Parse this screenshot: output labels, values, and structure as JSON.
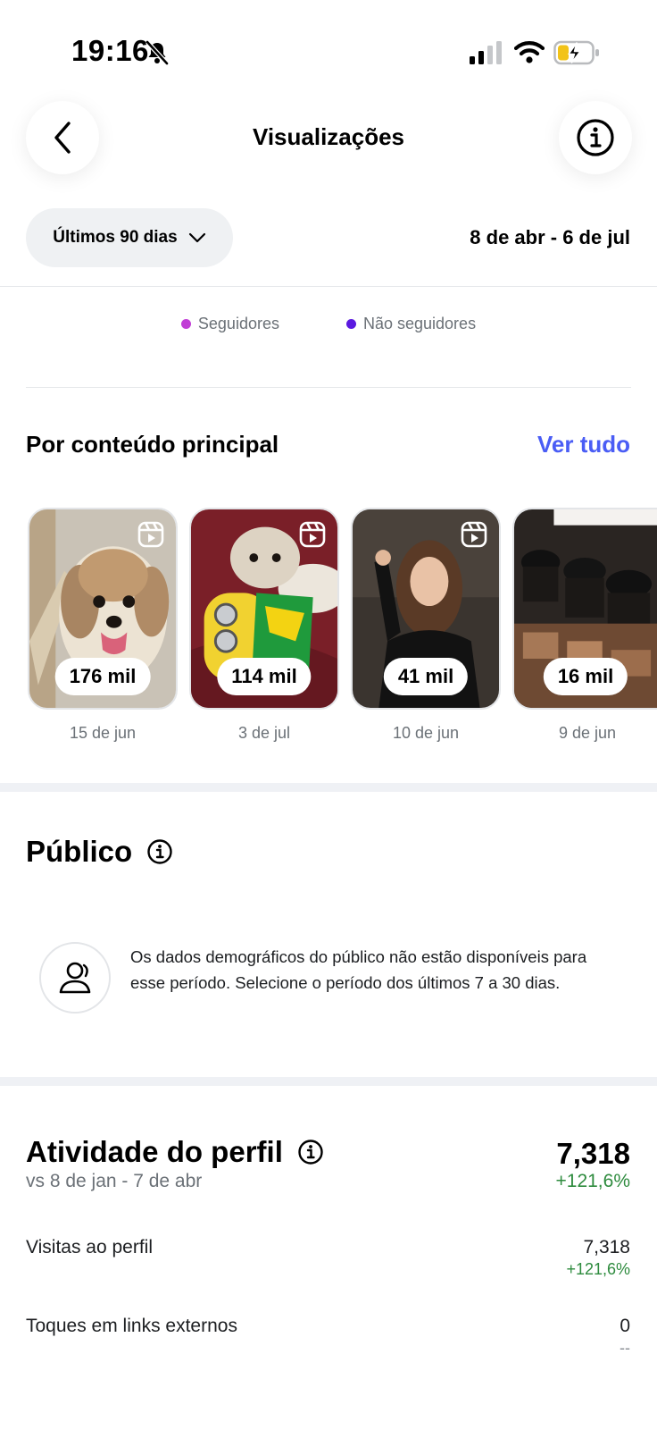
{
  "status_bar": {
    "time": "19:16",
    "icons": [
      "bell-muted-icon",
      "cellular-signal-icon",
      "wifi-icon",
      "battery-charging-icon"
    ]
  },
  "header": {
    "title": "Visualizações",
    "back_icon": "chevron-left-icon",
    "info_icon": "info-icon"
  },
  "filter": {
    "period_label": "Últimos 90 dias",
    "date_range": "8 de abr - 6 de jul"
  },
  "legend": [
    {
      "label": "Seguidores",
      "color": "#c13ed6"
    },
    {
      "label": "Não seguidores",
      "color": "#5b19e0"
    }
  ],
  "top_content": {
    "title": "Por conteúdo principal",
    "see_all": "Ver tudo",
    "items": [
      {
        "views": "176 mil",
        "date": "15 de jun"
      },
      {
        "views": "114 mil",
        "date": "3 de jul"
      },
      {
        "views": "41 mil",
        "date": "10 de jun"
      },
      {
        "views": "16 mil",
        "date": "9 de jun"
      }
    ]
  },
  "audience": {
    "title": "Público",
    "message": "Os dados demográficos do público não estão disponíveis para esse período. Selecione o período dos últimos 7 a 30 dias."
  },
  "profile_activity": {
    "title": "Atividade do perfil",
    "comparison": "vs 8 de jan - 7 de abr",
    "total": "7,318",
    "total_change": "+121,6%",
    "metrics": [
      {
        "label": "Visitas ao perfil",
        "value": "7,318",
        "change": "+121,6%"
      },
      {
        "label": "Toques em links externos",
        "value": "0",
        "change": "--"
      }
    ]
  },
  "colors": {
    "accent_link": "#4a5df5",
    "positive": "#2e8b3e",
    "chip_bg": "#eff1f3"
  }
}
